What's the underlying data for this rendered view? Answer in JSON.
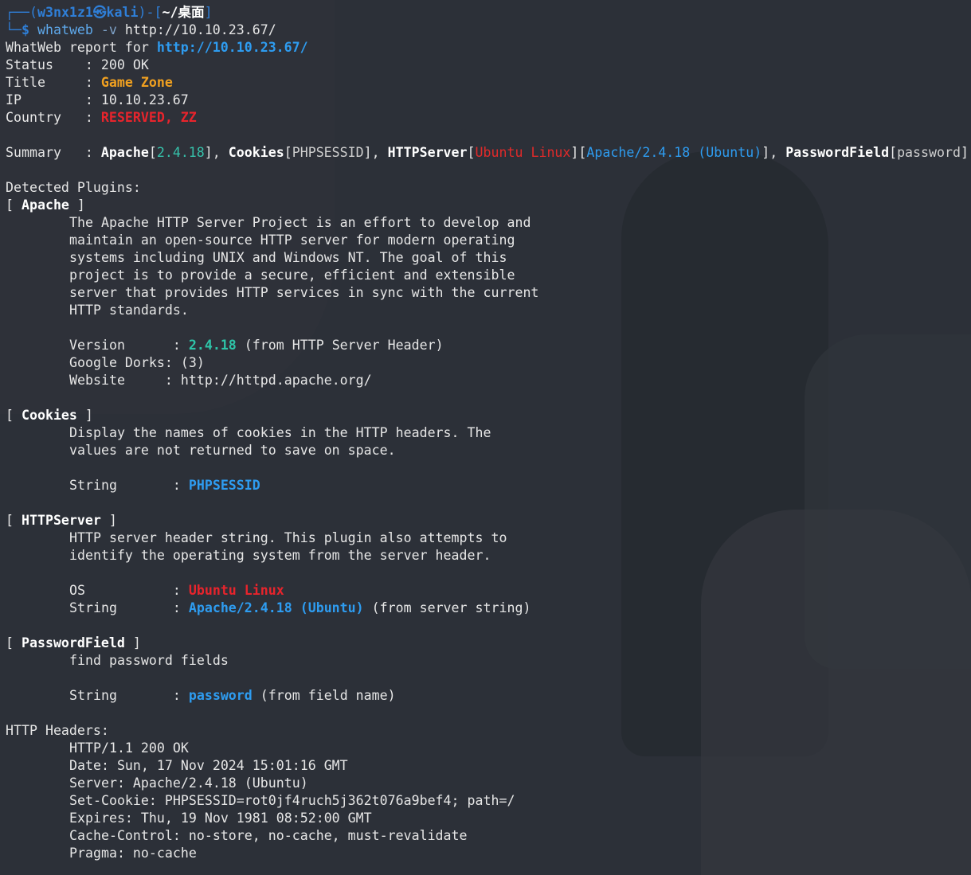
{
  "prompt": {
    "frame_top": "┌──(",
    "user": "w3nx1z1㉿kali",
    "frame_mid": ")-[",
    "path": "~/桌面",
    "frame_end": "]",
    "frame_bottom": "└─",
    "dollar": "$",
    "cmd": "whatweb",
    "flag": "-v",
    "arg": "http://10.10.23.67/"
  },
  "report": {
    "header_prefix": "WhatWeb report for ",
    "url": "http://10.10.23.67/",
    "status_label": "Status    : ",
    "status": "200 OK",
    "title_label": "Title     : ",
    "title": "Game Zone",
    "ip_label": "IP        : ",
    "ip": "10.10.23.67",
    "country_label": "Country   : ",
    "country": "RESERVED, ZZ"
  },
  "summary": {
    "label": "Summary   : ",
    "apache": "Apache",
    "apache_ver": "2.4.18",
    "cookies": "Cookies",
    "cookies_val": "PHPSESSID",
    "httpserver": "HTTPServer",
    "os": "Ubuntu Linux",
    "server_str": "Apache/2.4.18 (Ubuntu)",
    "pwfield": "PasswordField",
    "pwfield_val": "password"
  },
  "plugins": {
    "heading": "Detected Plugins:",
    "apache": {
      "name": "Apache",
      "desc": [
        "The Apache HTTP Server Project is an effort to develop and",
        "maintain an open-source HTTP server for modern operating",
        "systems including UNIX and Windows NT. The goal of this",
        "project is to provide a secure, efficient and extensible",
        "server that provides HTTP services in sync with the current",
        "HTTP standards."
      ],
      "version_label": "Version      : ",
      "version": "2.4.18",
      "version_note": " (from HTTP Server Header)",
      "dorks_label": "Google Dorks: ",
      "dorks": "(3)",
      "website_label": "Website     : ",
      "website": "http://httpd.apache.org/"
    },
    "cookies": {
      "name": "Cookies",
      "desc": [
        "Display the names of cookies in the HTTP headers. The",
        "values are not returned to save on space."
      ],
      "string_label": "String       : ",
      "string": "PHPSESSID"
    },
    "httpserver": {
      "name": "HTTPServer",
      "desc": [
        "HTTP server header string. This plugin also attempts to",
        "identify the operating system from the server header."
      ],
      "os_label": "OS           : ",
      "os": "Ubuntu Linux",
      "string_label": "String       : ",
      "string": "Apache/2.4.18 (Ubuntu)",
      "string_note": " (from server string)"
    },
    "passwordfield": {
      "name": "PasswordField",
      "desc": [
        "find password fields"
      ],
      "string_label": "String       : ",
      "string": "password",
      "string_note": " (from field name)"
    }
  },
  "headers": {
    "heading": "HTTP Headers:",
    "lines": [
      "HTTP/1.1 200 OK",
      "Date: Sun, 17 Nov 2024 15:01:16 GMT",
      "Server: Apache/2.4.18 (Ubuntu)",
      "Set-Cookie: PHPSESSID=rot0jf4ruch5j362t076a9bef4; path=/",
      "Expires: Thu, 19 Nov 1981 08:52:00 GMT",
      "Cache-Control: no-store, no-cache, must-revalidate",
      "Pragma: no-cache"
    ]
  }
}
